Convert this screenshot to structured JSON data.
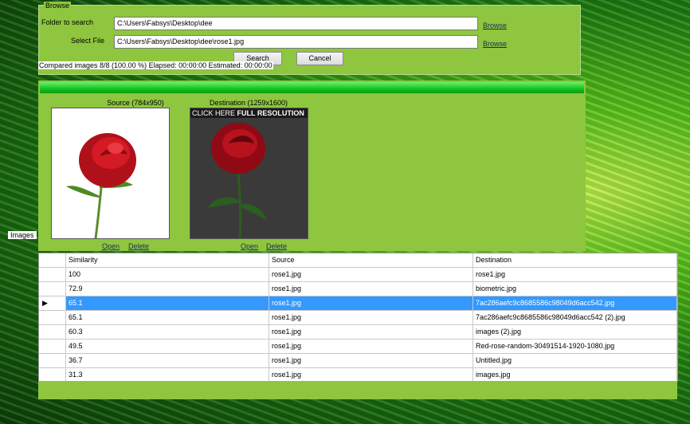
{
  "browse": {
    "legend": "Browse",
    "folder_label": "Folder to search",
    "folder_value": "C:\\Users\\Fabsys\\Desktop\\dee",
    "file_label": "Select File",
    "file_value": "C:\\Users\\Fabsys\\Desktop\\dee\\rose1.jpg",
    "browse_link": "Browse",
    "search_button": "Search",
    "cancel_button": "Cancel"
  },
  "status_text": "Compared images 8/8 (100.00 %) Elapsed: 00:00:00 Estimated: 00:00:00",
  "images_label": "Images",
  "preview": {
    "source_caption": "Source (784x950)",
    "destination_caption": "Destination (1259x1600)",
    "banner_plain": "CLICK HERE",
    "banner_bold": "FULL RESOLUTION",
    "open_link": "Open",
    "delete_link": "Delete"
  },
  "colors": {
    "panel_green": "#8ec63f",
    "selection_blue": "#3399ff",
    "rose_red": "#c0101a"
  },
  "grid": {
    "columns": [
      "Similarity",
      "Source",
      "Destination"
    ],
    "selected_marker": "▶",
    "rows": [
      [
        "100",
        "rose1.jpg",
        "rose1.jpg"
      ],
      [
        "72.9",
        "rose1.jpg",
        "biometric.jpg"
      ],
      [
        "65.1",
        "rose1.jpg",
        "7ac286aefc9c8685586c98049d6acc542.jpg"
      ],
      [
        "65.1",
        "rose1.jpg",
        "7ac286aefc9c8685586c98049d6acc542 (2).jpg"
      ],
      [
        "60.3",
        "rose1.jpg",
        "images (2).jpg"
      ],
      [
        "49.5",
        "rose1.jpg",
        "Red-rose-random-30491514-1920-1080.jpg"
      ],
      [
        "36.7",
        "rose1.jpg",
        "Untitled.jpg"
      ],
      [
        "31.3",
        "rose1.jpg",
        "images.jpg"
      ]
    ]
  }
}
